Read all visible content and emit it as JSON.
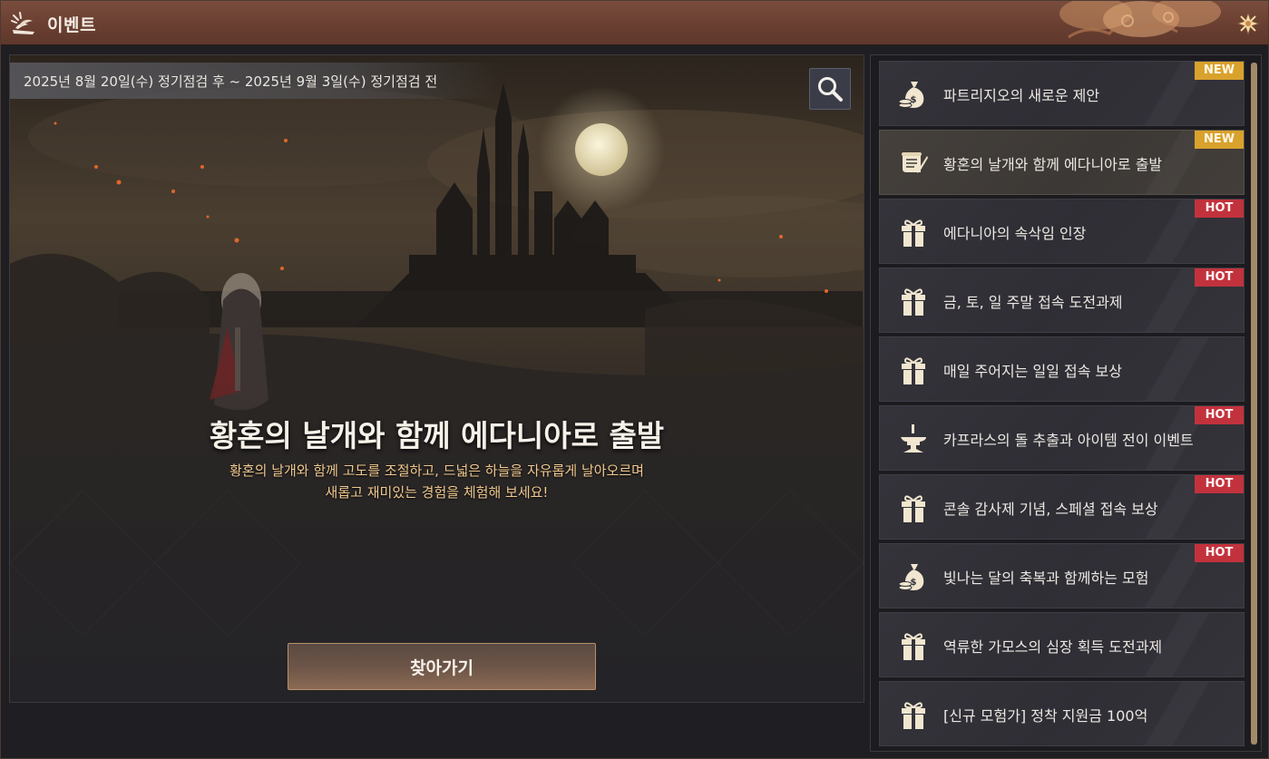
{
  "window": {
    "title": "이벤트",
    "title_icon": "fan-feather-icon",
    "corner_icon": "flower-ornament-icon"
  },
  "banner": {
    "period": "2025년 8월 20일(수) 정기점검 후 ~ 2025년 9월 3일(수) 정기점검 전",
    "headline": "황혼의 날개와 함께 에다니아로 출발",
    "sub_line_1": "황혼의 날개와 함께 고도를 조절하고, 드넓은 하늘을 자유롭게 날아오르며",
    "sub_line_2": "새롭고 재미있는 경험을 체험해 보세요!",
    "go_button": "찾아가기",
    "search_icon": "search-icon"
  },
  "events": [
    {
      "label": "파트리지오의 새로운 제안",
      "badge": "NEW",
      "badge_type": "new",
      "icon": "money-bag-icon",
      "selected": false
    },
    {
      "label": "황혼의 날개와 함께 에다니아로 출발",
      "badge": "NEW",
      "badge_type": "new",
      "icon": "scroll-quill-icon",
      "selected": true
    },
    {
      "label": "에다니아의 속삭임 인장",
      "badge": "HOT",
      "badge_type": "hot",
      "icon": "gift-box-icon",
      "selected": false
    },
    {
      "label": "금, 토, 일 주말 접속 도전과제",
      "badge": "HOT",
      "badge_type": "hot",
      "icon": "gift-box-icon",
      "selected": false
    },
    {
      "label": "매일 주어지는 일일 접속 보상",
      "badge": "",
      "badge_type": "",
      "icon": "gift-box-icon",
      "selected": false
    },
    {
      "label": "카프라스의 돌 추출과 아이템 전이 이벤트",
      "badge": "HOT",
      "badge_type": "hot",
      "icon": "anvil-icon",
      "selected": false
    },
    {
      "label": "콘솔 감사제 기념, 스페셜 접속 보상",
      "badge": "HOT",
      "badge_type": "hot",
      "icon": "gift-box-icon",
      "selected": false
    },
    {
      "label": "빛나는 달의 축복과 함께하는 모험",
      "badge": "HOT",
      "badge_type": "hot",
      "icon": "money-bag-icon",
      "selected": false
    },
    {
      "label": "역류한 가모스의 심장 획득 도전과제",
      "badge": "",
      "badge_type": "",
      "icon": "gift-box-icon",
      "selected": false
    },
    {
      "label": "[신규 모험가] 정착 지원금 100억",
      "badge": "",
      "badge_type": "",
      "icon": "gift-box-icon",
      "selected": false
    }
  ],
  "colors": {
    "titlebar": "#6a3f31",
    "badge_new": "#d9a22d",
    "badge_hot": "#c2323d",
    "accent_gold": "#f0c98f",
    "scroll_thumb": "#a28a68"
  }
}
